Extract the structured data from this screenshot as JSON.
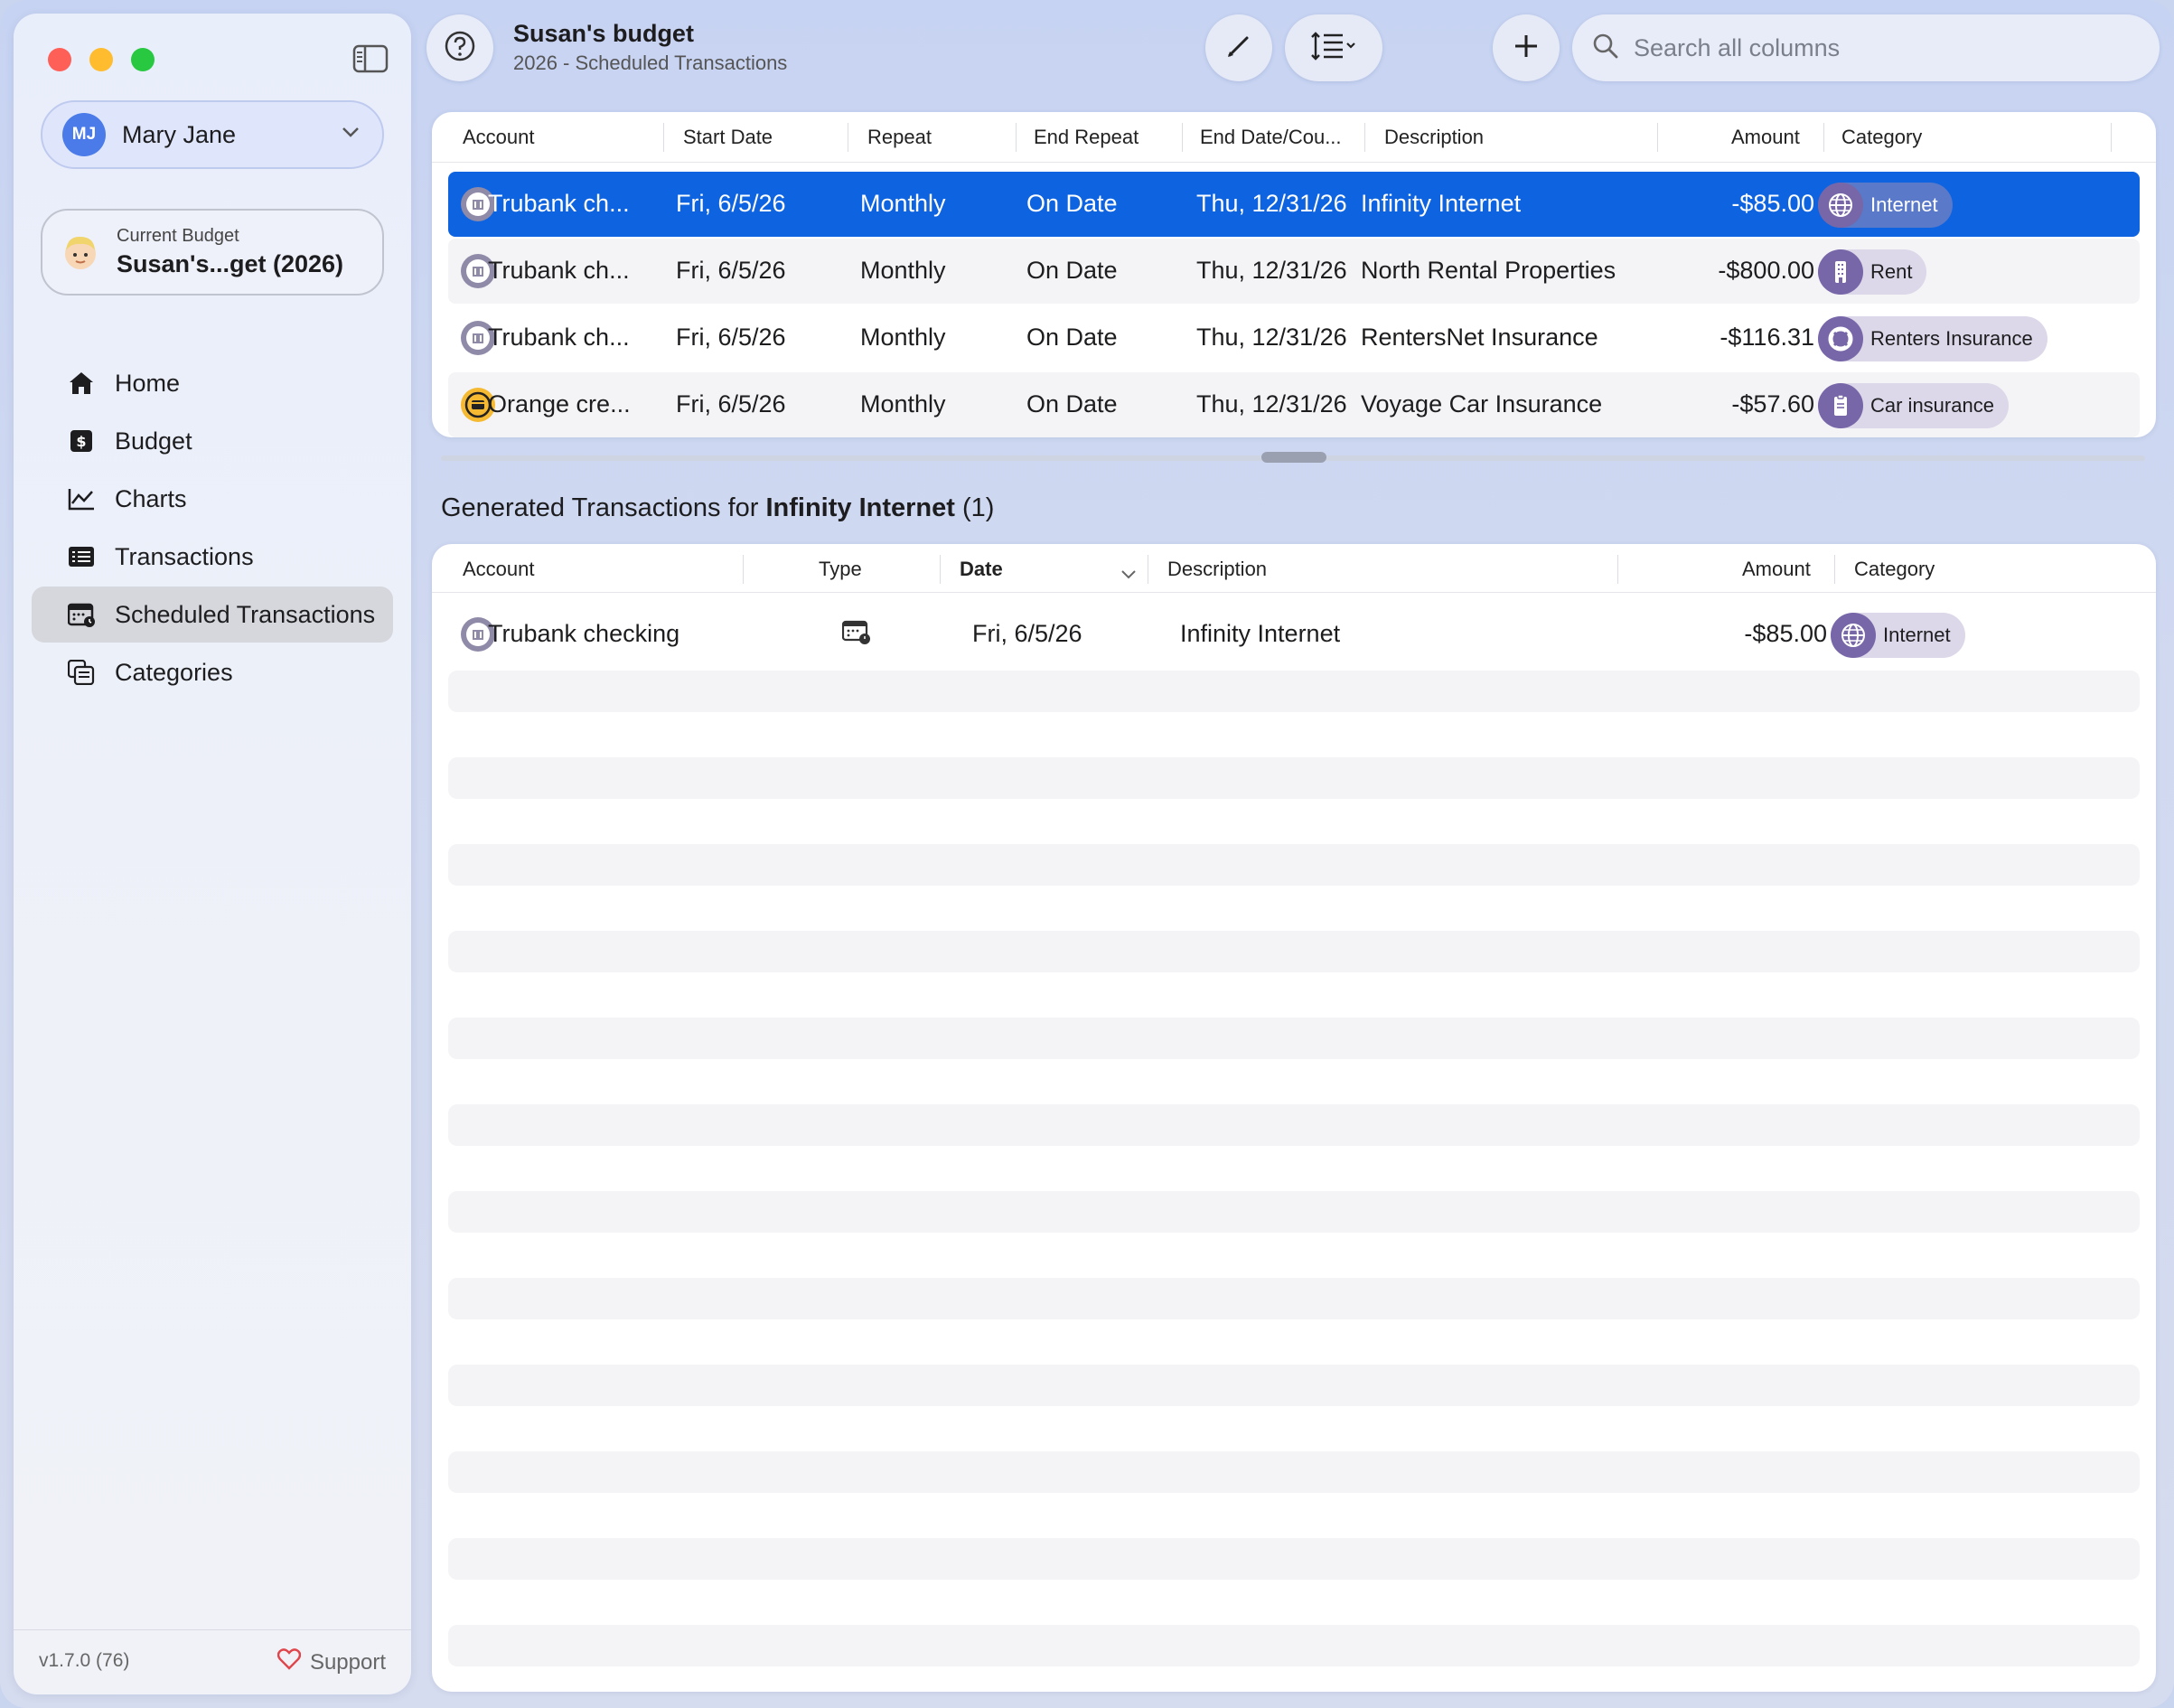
{
  "sidebar": {
    "user": {
      "initials": "MJ",
      "name": "Mary Jane"
    },
    "budget_card": {
      "label": "Current Budget",
      "name": "Susan's...get (2026)"
    },
    "nav": [
      {
        "label": "Home",
        "icon": "home-icon"
      },
      {
        "label": "Budget",
        "icon": "dollar-square-icon"
      },
      {
        "label": "Charts",
        "icon": "line-chart-icon"
      },
      {
        "label": "Transactions",
        "icon": "list-icon"
      },
      {
        "label": "Scheduled Transactions",
        "icon": "calendar-clock-icon",
        "active": true
      },
      {
        "label": "Categories",
        "icon": "categories-icon"
      }
    ],
    "version": "v1.7.0 (76)",
    "support": "Support"
  },
  "toolbar": {
    "title": "Susan's budget",
    "subtitle": "2026 - Scheduled Transactions",
    "search_placeholder": "Search all columns"
  },
  "scheduled_table": {
    "headers": [
      "Account",
      "Start Date",
      "Repeat",
      "End Repeat",
      "End Date/Cou...",
      "Description",
      "Amount",
      "Category"
    ],
    "rows": [
      {
        "account": "Trubank ch...",
        "start": "Fri, 6/5/26",
        "repeat": "Monthly",
        "end_repeat": "On Date",
        "end_date": "Thu, 12/31/26",
        "description": "Infinity Internet",
        "amount": "-$85.00",
        "category": "Internet",
        "account_icon": "bank-icon",
        "category_icon": "globe-icon"
      },
      {
        "account": "Trubank ch...",
        "start": "Fri, 6/5/26",
        "repeat": "Monthly",
        "end_repeat": "On Date",
        "end_date": "Thu, 12/31/26",
        "description": "North Rental Properties",
        "amount": "-$800.00",
        "category": "Rent",
        "account_icon": "bank-icon",
        "category_icon": "building-icon"
      },
      {
        "account": "Trubank ch...",
        "start": "Fri, 6/5/26",
        "repeat": "Monthly",
        "end_repeat": "On Date",
        "end_date": "Thu, 12/31/26",
        "description": "RentersNet Insurance",
        "amount": "-$116.31",
        "category": "Renters Insurance",
        "account_icon": "bank-icon",
        "category_icon": "lifebuoy-icon"
      },
      {
        "account": "Orange cre...",
        "start": "Fri, 6/5/26",
        "repeat": "Monthly",
        "end_repeat": "On Date",
        "end_date": "Thu, 12/31/26",
        "description": "Voyage Car Insurance",
        "amount": "-$57.60",
        "category": "Car insurance",
        "account_icon": "credit-card-icon",
        "category_icon": "clipboard-icon"
      }
    ]
  },
  "generated": {
    "title_prefix": "Generated Transactions for ",
    "title_name": "Infinity Internet",
    "title_count": " (1)",
    "headers": [
      "Account",
      "Type",
      "Date",
      "Description",
      "Amount",
      "Category"
    ],
    "rows": [
      {
        "account": "Trubank checking",
        "type_icon": "scheduled-icon",
        "date": "Fri, 6/5/26",
        "description": "Infinity Internet",
        "amount": "-$85.00",
        "category": "Internet"
      }
    ]
  },
  "colors": {
    "selection": "#0e63e0",
    "accent_avatar": "#4a7be8",
    "category_pill": "#dcd7e9",
    "category_icon_bg": "#7766a8"
  }
}
